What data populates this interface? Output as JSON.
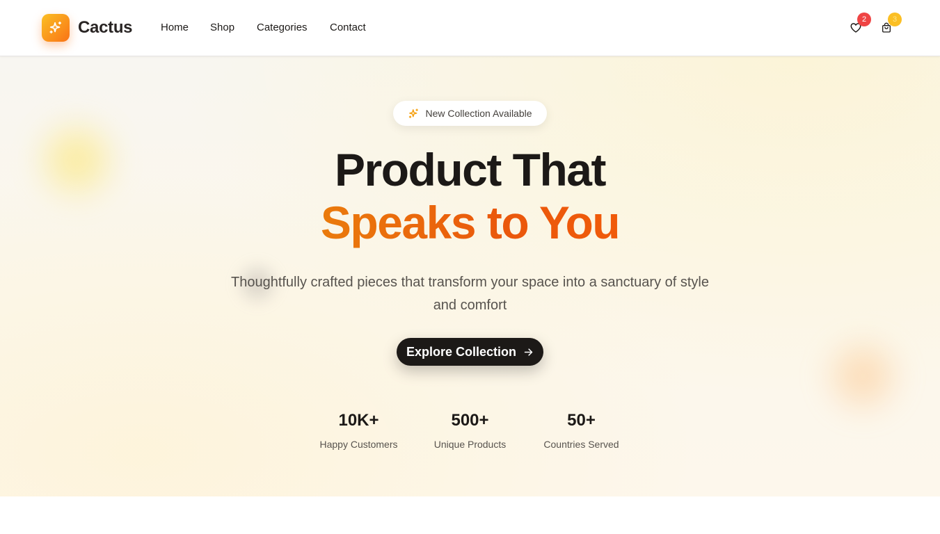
{
  "brand": {
    "name": "Cactus",
    "logo_icon": "sparkles-icon",
    "gradient": [
      "#fbbf24",
      "#f97316"
    ]
  },
  "nav": {
    "items": [
      {
        "label": "Home"
      },
      {
        "label": "Shop"
      },
      {
        "label": "Categories"
      },
      {
        "label": "Contact"
      }
    ]
  },
  "header_actions": {
    "wishlist": {
      "icon": "heart-icon",
      "count": "2",
      "badge_color": "#ef4444"
    },
    "cart": {
      "icon": "shopping-bag-icon",
      "count": "3",
      "badge_color": "#fbbf24"
    }
  },
  "hero": {
    "pill": {
      "icon": "sparkles-icon",
      "text": "New Collection Available"
    },
    "headline_line1": "Product That",
    "headline_line2": "Speaks to You",
    "subtitle": "Thoughtfully crafted pieces that transform your space into a sanctuary of style and comfort",
    "cta": {
      "label": "Explore Collection",
      "icon": "arrow-right-icon"
    },
    "stats": [
      {
        "value": "10K+",
        "label": "Happy Customers"
      },
      {
        "value": "500+",
        "label": "Unique Products"
      },
      {
        "value": "50+",
        "label": "Countries Served"
      }
    ]
  },
  "colors": {
    "accent": "#ea580c",
    "text_dark": "#1c1917",
    "text_muted": "#57534e"
  }
}
